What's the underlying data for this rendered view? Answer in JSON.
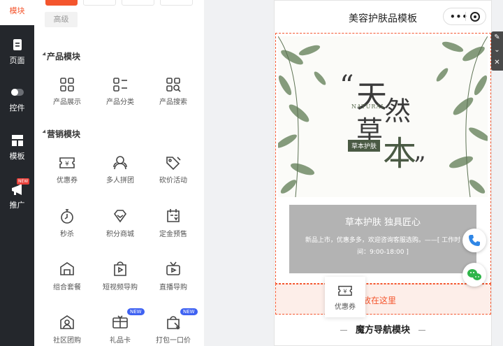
{
  "rail": {
    "items": [
      {
        "label": "模块",
        "icon": "module-icon",
        "active": true
      },
      {
        "label": "页面",
        "icon": "page-icon"
      },
      {
        "label": "控件",
        "icon": "toggle-icon"
      },
      {
        "label": "模板",
        "icon": "template-icon"
      },
      {
        "label": "推广",
        "icon": "megaphone-icon",
        "badge": "NEW"
      }
    ]
  },
  "panel": {
    "advanced_label": "高级",
    "sections": [
      {
        "title": "产品模块"
      },
      {
        "title": "营销模块"
      }
    ],
    "product_items": [
      {
        "label": "产品展示",
        "icon": "grid-icon"
      },
      {
        "label": "产品分类",
        "icon": "list-icon"
      },
      {
        "label": "产品搜索",
        "icon": "search-grid-icon"
      }
    ],
    "marketing_items": [
      {
        "label": "优惠券",
        "icon": "coupon-icon"
      },
      {
        "label": "多人拼团",
        "icon": "group-icon"
      },
      {
        "label": "砍价活动",
        "icon": "bargain-icon"
      },
      {
        "label": "秒杀",
        "icon": "stopwatch-icon"
      },
      {
        "label": "积分商城",
        "icon": "diamond-icon"
      },
      {
        "label": "定金预售",
        "icon": "presale-icon"
      },
      {
        "label": "组合套餐",
        "icon": "bundle-icon"
      },
      {
        "label": "短视频导购",
        "icon": "video-bag-icon"
      },
      {
        "label": "直播导购",
        "icon": "live-tv-icon"
      },
      {
        "label": "社区团购",
        "icon": "community-icon"
      },
      {
        "label": "礼品卡",
        "icon": "gift-card-icon",
        "badge": "NEW"
      },
      {
        "label": "打包一口价",
        "icon": "package-icon",
        "badge": "NEW"
      }
    ]
  },
  "phone": {
    "title": "美容护肤品模板",
    "capsule_dots": "•••",
    "banner": {
      "char1": "天",
      "char2": "然",
      "char3": "草",
      "char4": "本",
      "open_quote": "“",
      "close_quote": "”",
      "natural": "NATURAL",
      "tag": "草本护肤"
    },
    "info": {
      "heading": "草本护肤 独具匠心",
      "body": "新品上市，优惠多多，欢迎咨询客服选购。——[ 工作时间：9:00-18:00 ]"
    },
    "drop_text": "放在这里",
    "drag_item": "优惠券",
    "nav_module": "魔方导航模块"
  },
  "colors": {
    "accent": "#f4552d",
    "rail_bg": "#24272c",
    "new_badge": "#3f62f2"
  }
}
